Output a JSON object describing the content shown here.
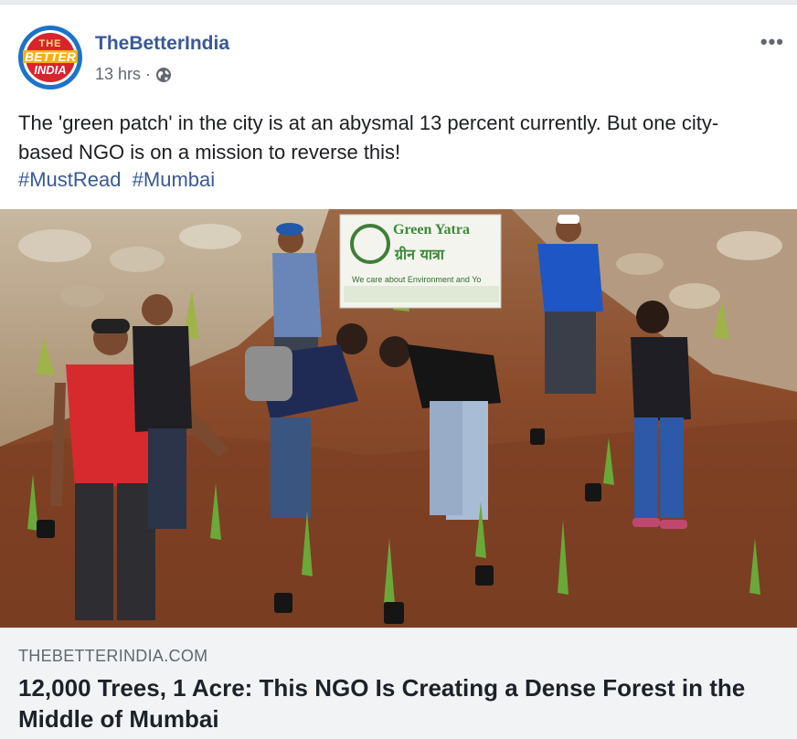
{
  "page": {
    "name": "TheBetterIndia",
    "time": "13 hrs",
    "separator": "·",
    "visibility_icon": "globe-icon",
    "avatar_logo": {
      "top": "THE",
      "middle": "BETTER",
      "bottom": "INDIA"
    },
    "more_options_label": "•••"
  },
  "post": {
    "text": "The 'green patch' in the city is at an abysmal 13 percent currently. But one city-based NGO is on a mission to reverse this!",
    "hashtags": [
      "#MustRead",
      "#Mumbai"
    ]
  },
  "photo": {
    "banner_title": "Green Yatra",
    "banner_hindi": "ग्रीन यात्रा",
    "banner_tagline": "We care about Environment and Yo"
  },
  "link": {
    "domain": "THEBETTERINDIA.COM",
    "title": "12,000 Trees, 1 Acre: This NGO Is Creating a Dense Forest in the Middle of Mumbai"
  },
  "colors": {
    "link_blue": "#385898",
    "meta_gray": "#616770",
    "card_bg": "#f2f3f5",
    "logo_red": "#d9232d",
    "logo_blue": "#1d73c8"
  }
}
